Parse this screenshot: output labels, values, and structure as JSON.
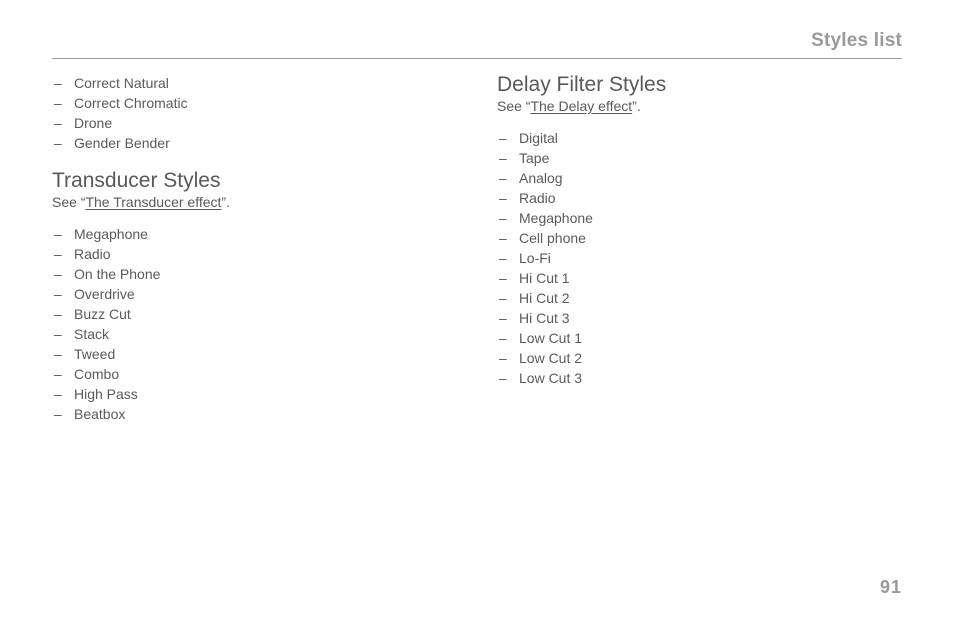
{
  "header": {
    "title": "Styles list"
  },
  "page_number": "91",
  "left": {
    "intro_items": [
      "Correct Natural",
      "Correct Chromatic",
      "Drone",
      "Gender Bender"
    ],
    "section": {
      "title": "Transducer Styles",
      "see_prefix": "See “",
      "see_link": "The Transducer effect",
      "see_suffix": "”.",
      "items": [
        "Megaphone",
        "Radio",
        "On the Phone",
        "Overdrive",
        "Buzz Cut",
        "Stack",
        "Tweed",
        "Combo",
        "High Pass",
        "Beatbox"
      ]
    }
  },
  "right": {
    "section": {
      "title": "Delay Filter Styles",
      "see_prefix": "See “",
      "see_link": "The Delay effect",
      "see_suffix": "”.",
      "items": [
        "Digital",
        "Tape",
        "Analog",
        "Radio",
        "Megaphone",
        "Cell phone",
        "Lo-Fi",
        "Hi Cut 1",
        "Hi Cut 2",
        "Hi Cut 3",
        "Low Cut 1",
        "Low Cut 2",
        "Low Cut 3"
      ]
    }
  }
}
